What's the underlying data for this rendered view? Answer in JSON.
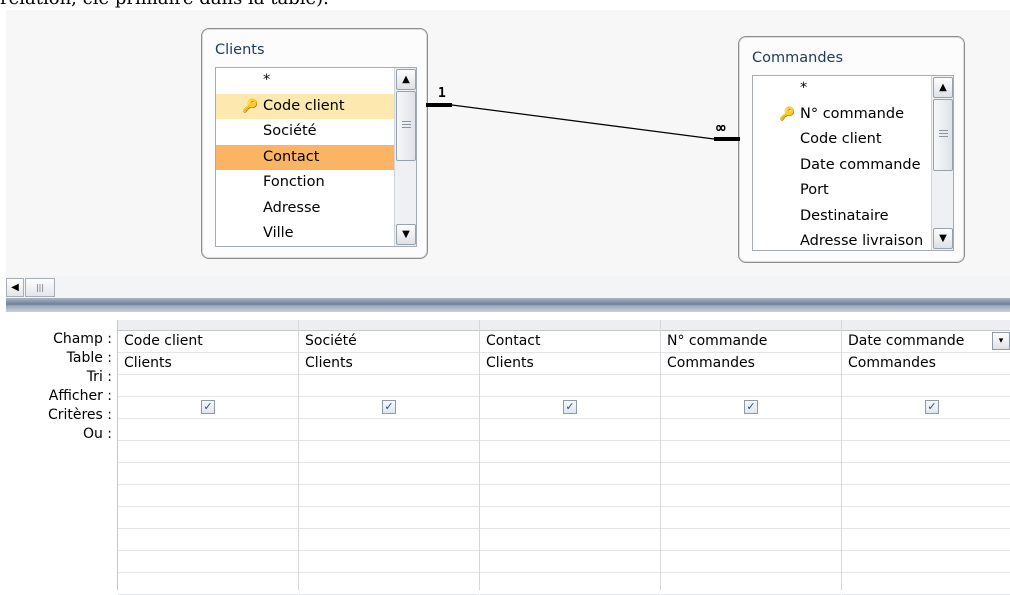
{
  "clipped_top_text": "relation, clé primaire dans la table).",
  "tables": [
    {
      "title": "Clients",
      "fields": [
        {
          "label": "*",
          "key": false,
          "state": "normal"
        },
        {
          "label": "Code client",
          "key": true,
          "state": "key"
        },
        {
          "label": "Société",
          "key": false,
          "state": "normal"
        },
        {
          "label": "Contact",
          "key": false,
          "state": "selected"
        },
        {
          "label": "Fonction",
          "key": false,
          "state": "normal"
        },
        {
          "label": "Adresse",
          "key": false,
          "state": "normal"
        },
        {
          "label": "Ville",
          "key": false,
          "state": "normal"
        }
      ]
    },
    {
      "title": "Commandes",
      "fields": [
        {
          "label": "*",
          "key": false,
          "state": "normal"
        },
        {
          "label": "N° commande",
          "key": true,
          "state": "normal"
        },
        {
          "label": "Code client",
          "key": false,
          "state": "normal"
        },
        {
          "label": "Date commande",
          "key": false,
          "state": "normal"
        },
        {
          "label": "Port",
          "key": false,
          "state": "normal"
        },
        {
          "label": "Destinataire",
          "key": false,
          "state": "normal"
        },
        {
          "label": "Adresse livraison",
          "key": false,
          "state": "normal"
        }
      ]
    }
  ],
  "relationship": {
    "one_label": "1",
    "many_label": "∞"
  },
  "icons": {
    "up": "▲",
    "down": "▼",
    "left": "◀",
    "grip": "|||",
    "check": "✓",
    "key": "🔑",
    "dropdown": "▾"
  },
  "row_labels": [
    "Champ :",
    "Table :",
    "Tri :",
    "Afficher :",
    "Critères :",
    "Ou :"
  ],
  "columns": [
    {
      "champ": "Code client",
      "table": "Clients",
      "tri": "",
      "afficher": true,
      "criteres": "",
      "ou": ""
    },
    {
      "champ": "Société",
      "table": "Clients",
      "tri": "",
      "afficher": true,
      "criteres": "",
      "ou": ""
    },
    {
      "champ": "Contact",
      "table": "Clients",
      "tri": "",
      "afficher": true,
      "criteres": "",
      "ou": ""
    },
    {
      "champ": "N° commande",
      "table": "Commandes",
      "tri": "",
      "afficher": true,
      "criteres": "",
      "ou": ""
    },
    {
      "champ": "Date commande",
      "table": "Commandes",
      "tri": "",
      "afficher": true,
      "criteres": "",
      "ou": "",
      "active": true
    }
  ],
  "colors": {
    "key_row": "#fde8b0",
    "selected_row": "#fbb464",
    "title_text": "#1e395b"
  }
}
